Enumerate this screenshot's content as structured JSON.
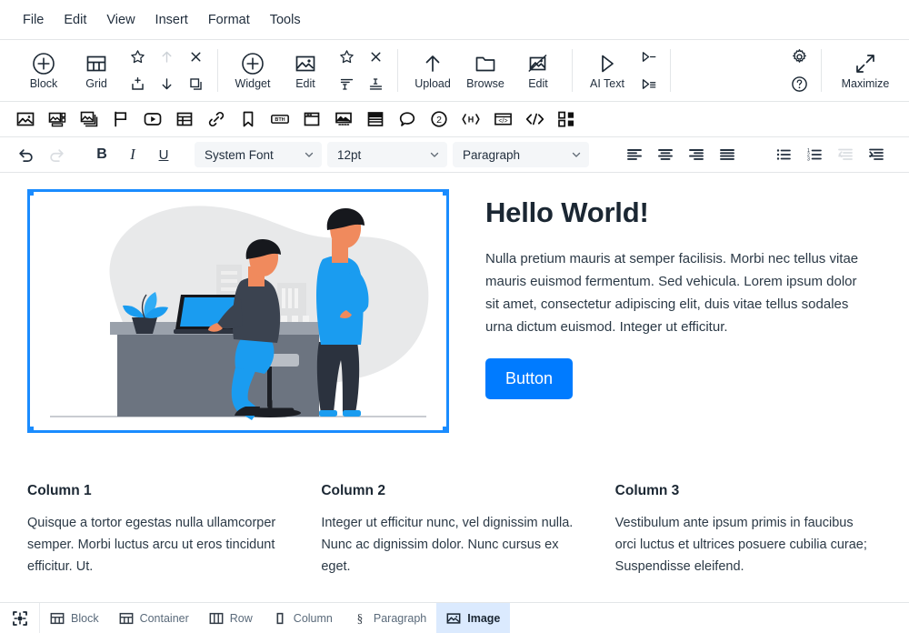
{
  "menubar": {
    "items": [
      {
        "label": "File",
        "name": "menu-file"
      },
      {
        "label": "Edit",
        "name": "menu-edit"
      },
      {
        "label": "View",
        "name": "menu-view"
      },
      {
        "label": "Insert",
        "name": "menu-insert"
      },
      {
        "label": "Format",
        "name": "menu-format"
      },
      {
        "label": "Tools",
        "name": "menu-tools"
      }
    ]
  },
  "toolbar_main": {
    "block_label": "Block",
    "grid_label": "Grid",
    "widget_label": "Widget",
    "edit_label": "Edit",
    "upload_label": "Upload",
    "browse_label": "Browse",
    "edit2_label": "Edit",
    "ai_text_label": "AI Text",
    "maximize_label": "Maximize",
    "icons": {
      "block": "plus-circle-icon",
      "grid": "grid-icon",
      "star": "star-icon",
      "move_up": "arrow-up-icon",
      "close": "close-icon",
      "insert_row": "insert-row-icon",
      "move_down": "arrow-down-icon",
      "duplicate": "duplicate-icon",
      "widget": "plus-circle-icon",
      "edit_image": "image-icon",
      "star2": "star-icon",
      "close2": "close-icon",
      "align_top": "align-top-icon",
      "align_bottom": "align-bottom-icon",
      "upload": "arrow-up-icon",
      "browse": "folder-icon",
      "edit_img2": "image-edit-icon",
      "ai_text": "play-triangle-icon",
      "ai_line": "ai-line-icon",
      "ai_lines": "ai-lines-icon",
      "settings": "gear-icon",
      "help": "question-circle-icon",
      "maximize": "maximize-icon"
    }
  },
  "toolbar_icons": {
    "items": [
      {
        "name": "image-icon",
        "title": "Image"
      },
      {
        "name": "gallery-icon",
        "title": "Gallery"
      },
      {
        "name": "image-stack-icon",
        "title": "Slideshow"
      },
      {
        "name": "flag-icon",
        "title": "Banner"
      },
      {
        "name": "video-icon",
        "title": "Video"
      },
      {
        "name": "table-icon",
        "title": "Table"
      },
      {
        "name": "link-icon",
        "title": "Link"
      },
      {
        "name": "bookmark-icon",
        "title": "Bookmark"
      },
      {
        "name": "badge-bth-icon",
        "title": "BTH"
      },
      {
        "name": "window-icon",
        "title": "Window"
      },
      {
        "name": "image-caption-icon",
        "title": "Image caption"
      },
      {
        "name": "accordion-icon",
        "title": "Accordion"
      },
      {
        "name": "comment-icon",
        "title": "Comment"
      },
      {
        "name": "number-two-icon",
        "title": "Step 2"
      },
      {
        "name": "heading-tag-icon",
        "title": "Heading"
      },
      {
        "name": "code-window-icon",
        "title": "Embed"
      },
      {
        "name": "code-slash-icon",
        "title": "Source code"
      },
      {
        "name": "qr-code-icon",
        "title": "QR code"
      }
    ]
  },
  "toolbar_format": {
    "undo": "undo-icon",
    "redo": "redo-icon",
    "bold": "B",
    "italic": "I",
    "underline": "U",
    "font_family": "System Font",
    "font_size": "12pt",
    "block_format": "Paragraph",
    "align_left": "align-left-icon",
    "align_center": "align-center-icon",
    "align_right": "align-right-icon",
    "align_justify": "align-justify-icon",
    "bullet_list": "bullet-list-icon",
    "numbered_list": "numbered-list-icon",
    "outdent": "outdent-icon",
    "indent": "indent-icon"
  },
  "content": {
    "heading": "Hello World!",
    "paragraph": "Nulla pretium mauris at semper facilisis. Morbi nec tellus vitae mauris euismod fermentum. Sed vehicula. Lorem ipsum dolor sit amet, consectetur adipiscing elit, duis vitae tellus sodales urna dictum euismod. Integer ut efficitur.",
    "button_label": "Button",
    "image_alt": "illustration-two-men-desk-laptop",
    "columns": [
      {
        "title": "Column 1",
        "body": "Quisque a tortor egestas nulla ullamcorper semper. Morbi luctus arcu ut eros tincidunt efficitur. Ut."
      },
      {
        "title": "Column 2",
        "body": "Integer ut efficitur nunc, vel dignissim nulla. Nunc ac dignissim dolor. Nunc cursus ex eget."
      },
      {
        "title": "Column 3",
        "body": "Vestibulum ante ipsum primis in faucibus orci luctus et ultrices posuere cubilia curae; Suspendisse eleifend."
      }
    ]
  },
  "statusbar": {
    "tool_icon": "selection-tool-icon",
    "breadcrumbs": [
      {
        "label": "Block",
        "icon": "block-icon",
        "active": false
      },
      {
        "label": "Container",
        "icon": "container-icon",
        "active": false
      },
      {
        "label": "Row",
        "icon": "row-icon",
        "active": false
      },
      {
        "label": "Column",
        "icon": "column-icon",
        "active": false
      },
      {
        "label": "Paragraph",
        "icon": "paragraph-icon",
        "active": false
      },
      {
        "label": "Image",
        "icon": "image-icon",
        "active": true
      }
    ]
  },
  "colors": {
    "accent_blue": "#007bff",
    "selection_blue": "#1a8cff",
    "crumb_active_bg": "#dbeafe",
    "text_dark": "#1b2733"
  }
}
